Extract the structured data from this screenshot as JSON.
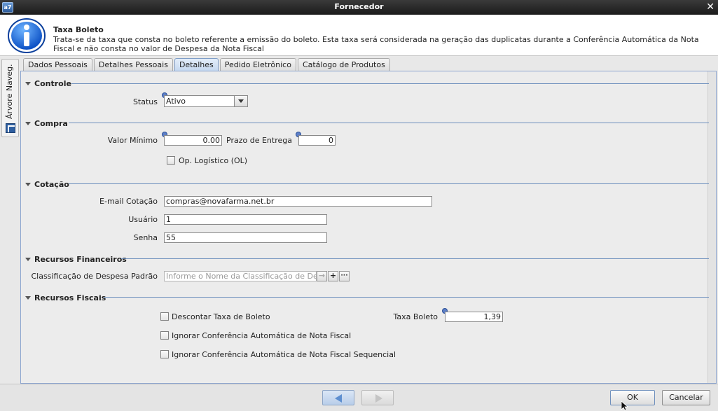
{
  "window": {
    "title": "Fornecedor",
    "app_icon_text": "a7",
    "close_glyph": "✕"
  },
  "info": {
    "title": "Taxa Boleto",
    "text": "Trata-se da taxa que consta no boleto referente a emissão do boleto. Esta taxa será considerada na geração das duplicatas durante a Conferência Automática da Nota Fiscal e não consta no valor de Despesa da Nota Fiscal"
  },
  "side_tab": {
    "label": "Árvore Naveg."
  },
  "tabs": [
    {
      "label": "Dados Pessoais",
      "active": false
    },
    {
      "label": "Detalhes Pessoais",
      "active": false
    },
    {
      "label": "Detalhes",
      "active": true
    },
    {
      "label": "Pedido Eletrônico",
      "active": false
    },
    {
      "label": "Catálogo de Produtos",
      "active": false
    }
  ],
  "sections": {
    "controle": {
      "title": "Controle",
      "status_label": "Status",
      "status_value": "Ativo"
    },
    "compra": {
      "title": "Compra",
      "valor_minimo_label": "Valor Mínimo",
      "valor_minimo_value": "0.00",
      "prazo_label": "Prazo de Entrega",
      "prazo_value": "0",
      "op_logistico_label": "Op. Logístico (OL)"
    },
    "cotacao": {
      "title": "Cotação",
      "email_label": "E-mail Cotação",
      "email_value": "compras@novafarma.net.br",
      "usuario_label": "Usuário",
      "usuario_value": "1",
      "senha_label": "Senha",
      "senha_value": "55"
    },
    "financeiros": {
      "title": "Recursos Financeiros",
      "classificacao_label": "Classificação de Despesa Padrão",
      "classificacao_placeholder": "Informe o Nome da Classificação de Des",
      "add_glyph": "+",
      "more_glyph": "···"
    },
    "fiscais": {
      "title": "Recursos Fiscais",
      "descontar_label": "Descontar Taxa de Boleto",
      "ignorar_label": "Ignorar Conferência Automática de Nota Fiscal",
      "ignorar_seq_label": "Ignorar Conferência Automática de Nota Fiscal Sequencial",
      "taxa_label": "Taxa Boleto",
      "taxa_value": "1,39"
    }
  },
  "footer": {
    "ok_label": "OK",
    "cancel_label": "Cancelar"
  },
  "colors": {
    "accent": "#6d8fbd",
    "active_tab": "#c6d8ef",
    "required_dot": "#5d7fc7"
  }
}
